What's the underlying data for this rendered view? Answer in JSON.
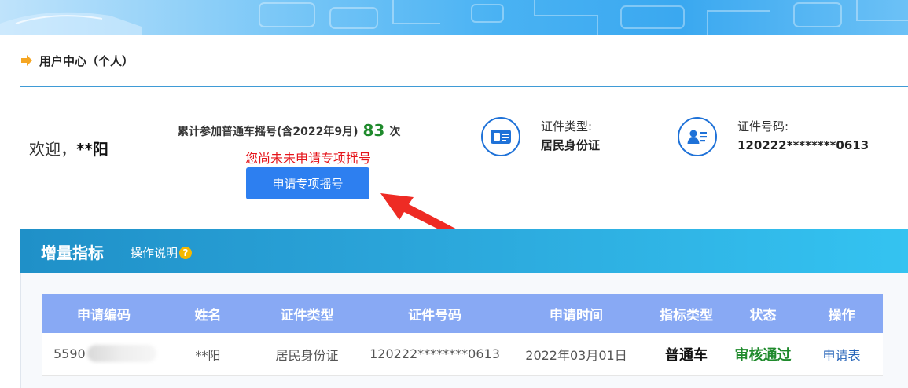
{
  "section": {
    "title": "用户中心（个人）"
  },
  "welcome": {
    "prefix": "欢迎，",
    "name": "**阳"
  },
  "lottery": {
    "text": "累计参加普通车摇号(含2022年9月)",
    "count": "83",
    "unit": "次",
    "notice": "您尚未未申请专项摇号",
    "button": "申请专项摇号"
  },
  "id_type": {
    "label": "证件类型:",
    "value": "居民身份证"
  },
  "id_number": {
    "label": "证件号码:",
    "value": "120222********0613"
  },
  "panel": {
    "title": "增量指标",
    "help": "操作说明",
    "help_icon": "?"
  },
  "table": {
    "headers": [
      "申请编码",
      "姓名",
      "证件类型",
      "证件号码",
      "申请时间",
      "指标类型",
      "状态",
      "操作"
    ],
    "row": {
      "code": "5590",
      "name": "**阳",
      "id_type": "居民身份证",
      "id_number": "120222********0613",
      "time": "2022年03月01日",
      "quota_type": "普通车",
      "status": "审核通过",
      "action": "申请表"
    }
  },
  "colors": {
    "accent": "#2d7ff0",
    "header_row": "#88a9f4",
    "success": "#1f8a2c",
    "warning": "#e5151b"
  }
}
